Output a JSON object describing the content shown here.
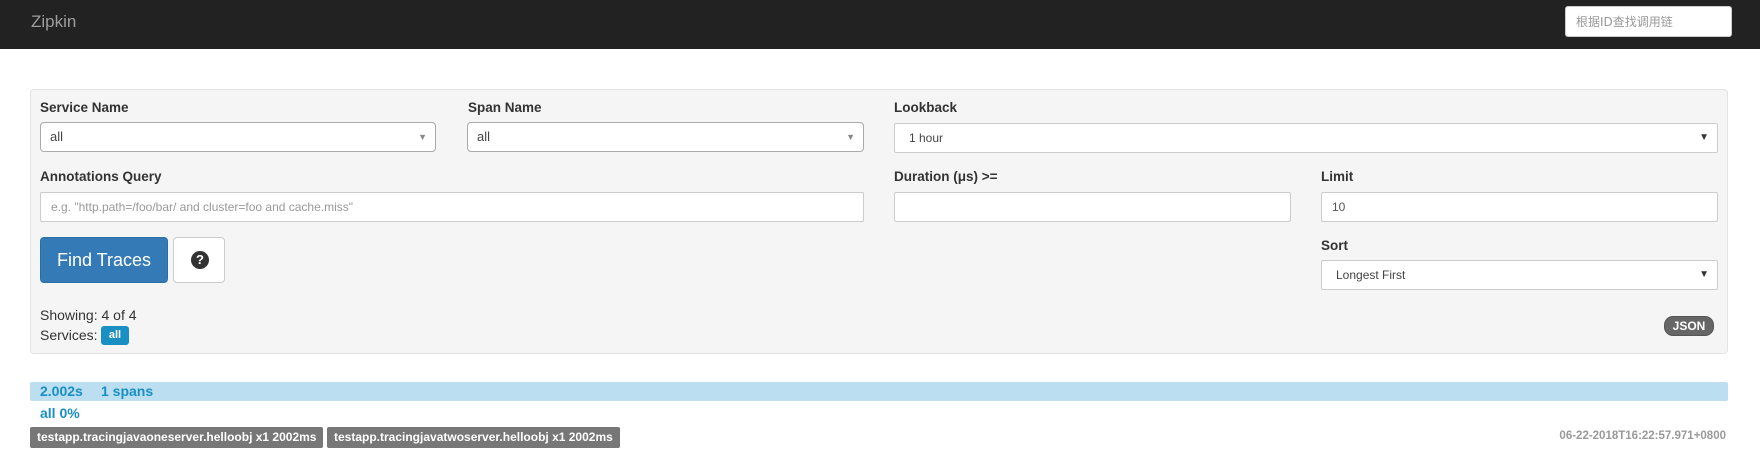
{
  "navbar": {
    "brand": "Zipkin",
    "id_search_placeholder": "根据ID查找调用链"
  },
  "form": {
    "service_name": {
      "label": "Service Name",
      "value": "all"
    },
    "span_name": {
      "label": "Span Name",
      "value": "all"
    },
    "lookback": {
      "label": "Lookback",
      "value": "1 hour"
    },
    "annotations_query": {
      "label": "Annotations Query",
      "placeholder": "e.g. \"http.path=/foo/bar/ and cluster=foo and cache.miss\"",
      "value": ""
    },
    "duration": {
      "label": "Duration (μs) >=",
      "value": ""
    },
    "limit": {
      "label": "Limit",
      "value": "10"
    },
    "sort": {
      "label": "Sort",
      "value": "Longest First"
    },
    "find_button": "Find Traces",
    "help_icon_glyph": "?"
  },
  "results": {
    "showing": "Showing: 4 of 4",
    "services_label": "Services:",
    "services_badge": "all",
    "json_badge": "JSON"
  },
  "traces": [
    {
      "duration": "2.002s",
      "spans": "1 spans",
      "service_pct": "all 0%",
      "service_tags": [
        "testapp.tracingjavaoneserver.helloobj x1 2002ms",
        "testapp.tracingjavatwoserver.helloobj x1 2002ms"
      ],
      "timestamp": "06-22-2018T16:22:57.971+0800"
    }
  ],
  "colors": {
    "navbar_bg": "#222222",
    "primary": "#337ab7",
    "accent": "#1a8fc4",
    "trace_bar": "#bbdef0",
    "tag_bg": "#777777"
  },
  "icons": {
    "help": "question-circle-icon",
    "dropdown": "caret-down-icon"
  }
}
